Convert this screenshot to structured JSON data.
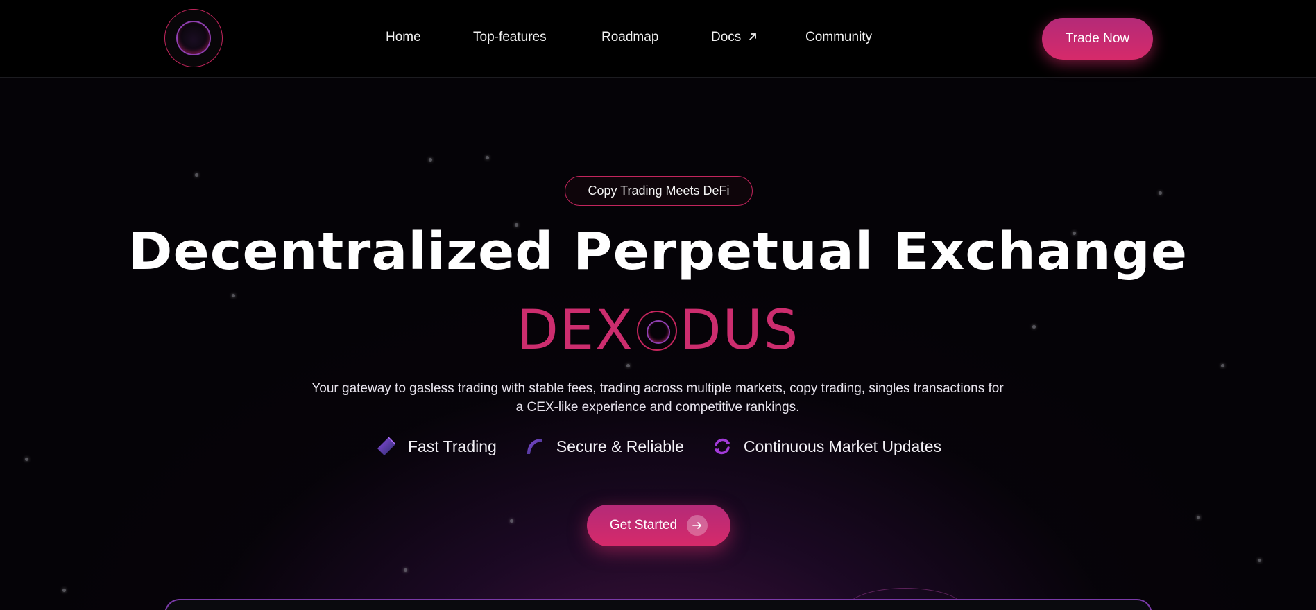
{
  "nav": {
    "links": [
      "Home",
      "Top-features",
      "Roadmap",
      "Docs",
      "Community"
    ],
    "docs_external_icon": "arrow-up-right-icon",
    "trade_button": "Trade Now",
    "logo_icon": "dexodus-logo-icon"
  },
  "hero": {
    "badge": "Copy Trading Meets DeFi",
    "headline": "Decentralized Perpetual Exchange",
    "brand_left": "DEX",
    "brand_right": "DUS",
    "description": "Your gateway to gasless trading with stable fees, trading across multiple markets, copy trading, singles transactions for a CEX-like experience and competitive rankings.",
    "features": [
      {
        "label": "Fast Trading",
        "icon": "diamond-icon"
      },
      {
        "label": "Secure & Reliable",
        "icon": "leaf-icon"
      },
      {
        "label": "Continuous Market Updates",
        "icon": "refresh-icon"
      }
    ],
    "cta": "Get Started",
    "cta_icon": "arrow-right-icon"
  },
  "colors": {
    "accent": "#d62a6a",
    "accent_purple": "#8e3fb0",
    "background": "#000000"
  }
}
